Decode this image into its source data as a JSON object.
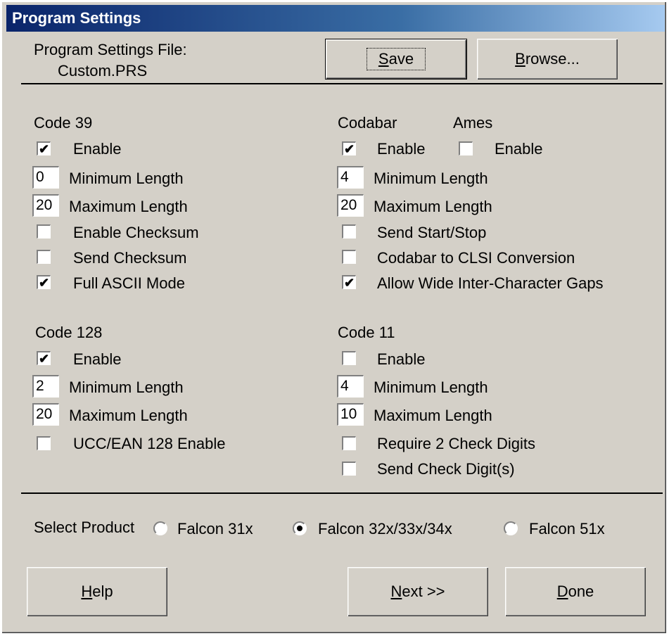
{
  "window": {
    "title": "Program Settings"
  },
  "file": {
    "label": "Program Settings File:",
    "name": "Custom.PRS"
  },
  "toolbar": {
    "save_label": "ave",
    "save_key": "S",
    "browse_label": "rowse...",
    "browse_key": "B"
  },
  "code39": {
    "title": "Code 39",
    "enable": {
      "label": "Enable",
      "checked": true
    },
    "min": {
      "value": "0",
      "label": "Minimum Length"
    },
    "max": {
      "value": "20",
      "label": "Maximum Length"
    },
    "enable_checksum": {
      "label": "Enable Checksum",
      "checked": false
    },
    "send_checksum": {
      "label": "Send Checksum",
      "checked": false
    },
    "full_ascii": {
      "label": "Full ASCII Mode",
      "checked": true
    }
  },
  "codabar": {
    "title": "Codabar",
    "enable": {
      "label": "Enable",
      "checked": true
    },
    "min": {
      "value": "4",
      "label": "Minimum Length"
    },
    "max": {
      "value": "20",
      "label": "Maximum Length"
    },
    "send_start_stop": {
      "label": "Send Start/Stop",
      "checked": false
    },
    "clsi": {
      "label": "Codabar to CLSI Conversion",
      "checked": false
    },
    "wide_gaps": {
      "label": "Allow Wide Inter-Character Gaps",
      "checked": true
    }
  },
  "ames": {
    "title": "Ames",
    "enable": {
      "label": "Enable",
      "checked": false
    }
  },
  "code128": {
    "title": "Code 128",
    "enable": {
      "label": "Enable",
      "checked": true
    },
    "min": {
      "value": "2",
      "label": "Minimum Length"
    },
    "max": {
      "value": "20",
      "label": "Maximum Length"
    },
    "ucc": {
      "label": "UCC/EAN 128 Enable",
      "checked": false
    }
  },
  "code11": {
    "title": "Code 11",
    "enable": {
      "label": "Enable",
      "checked": false
    },
    "min": {
      "value": "4",
      "label": "Minimum Length"
    },
    "max": {
      "value": "10",
      "label": "Maximum Length"
    },
    "require2": {
      "label": "Require 2 Check Digits",
      "checked": false
    },
    "send_digits": {
      "label": "Send Check Digit(s)",
      "checked": false
    }
  },
  "product": {
    "label": "Select Product",
    "options": [
      {
        "label": "Falcon 31x",
        "selected": false
      },
      {
        "label": "Falcon 32x/33x/34x",
        "selected": true
      },
      {
        "label": "Falcon 51x",
        "selected": false
      }
    ]
  },
  "footer": {
    "help_key": "H",
    "help_label": "elp",
    "next_key": "N",
    "next_label": "ext >>",
    "done_key": "D",
    "done_label": "one"
  }
}
